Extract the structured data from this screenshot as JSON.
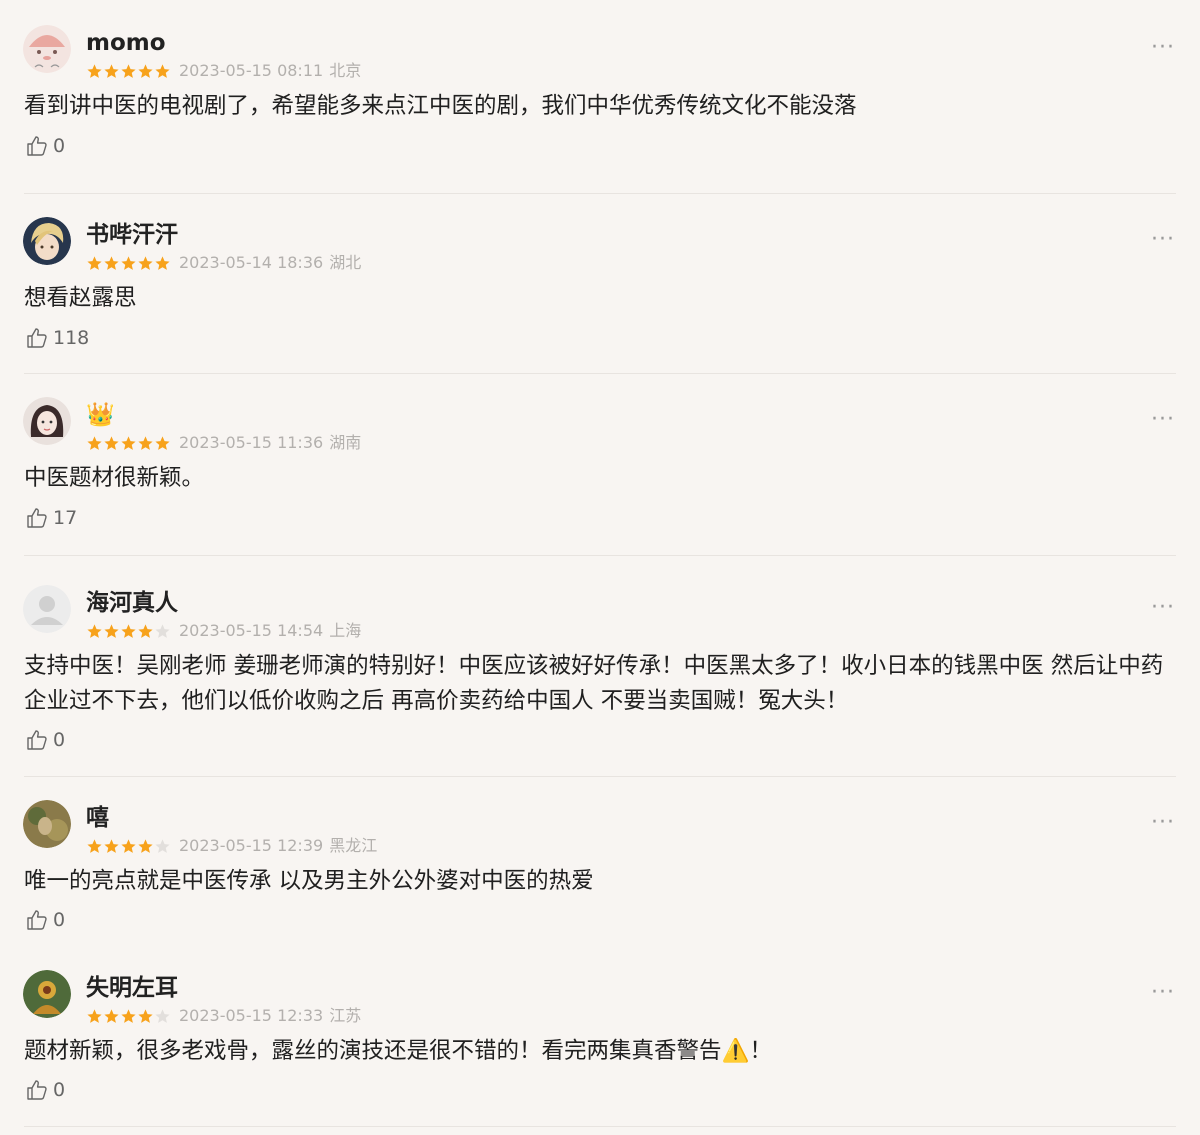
{
  "comments": [
    {
      "username": "momo",
      "rating": 5,
      "date": "2023-05-15 08:11",
      "location": "北京",
      "text": "看到讲中医的电视剧了，希望能多来点江中医的剧，我们中华优秀传统文化不能没落",
      "likes": "0",
      "avatar_icon": "pink-character-avatar",
      "more_label": "···"
    },
    {
      "username": "书哔汗汗",
      "rating": 5,
      "date": "2023-05-14 18:36",
      "location": "湖北",
      "text": "想看赵露思",
      "likes": "118",
      "avatar_icon": "blond-character-avatar",
      "more_label": "···"
    },
    {
      "username": "👑",
      "rating": 5,
      "date": "2023-05-15 11:36",
      "location": "湖南",
      "text": "中医题材很新颖。",
      "likes": "17",
      "avatar_icon": "cartoon-girl-avatar",
      "more_label": "···"
    },
    {
      "username": "海河真人",
      "rating": 4,
      "date": "2023-05-15 14:54",
      "location": "上海",
      "text": "支持中医！吴刚老师 姜珊老师演的特别好！中医应该被好好传承！中医黑太多了！收小日本的钱黑中医 然后让中药企业过不下去，他们以低价收购之后 再高价卖药给中国人 不要当卖国贼！冤大头！",
      "likes": "0",
      "avatar_icon": "default-gray-avatar",
      "more_label": "···"
    },
    {
      "username": "嘻",
      "rating": 4,
      "date": "2023-05-15 12:39",
      "location": "黑龙江",
      "text": "唯一的亮点就是中医传承 以及男主外公外婆对中医的热爱",
      "likes": "0",
      "avatar_icon": "photo-avatar",
      "more_label": "···"
    },
    {
      "username": "失明左耳",
      "rating": 4,
      "date": "2023-05-15 12:33",
      "location": "江苏",
      "text": "题材新颖，很多老戏骨，露丝的演技还是很不错的！看完两集真香警告⚠️！",
      "likes": "0",
      "avatar_icon": "green-figure-avatar",
      "more_label": "···"
    }
  ],
  "colors": {
    "star_filled": "#f7a21b",
    "star_empty": "#e2dfdc",
    "background": "#f8f5f2"
  }
}
